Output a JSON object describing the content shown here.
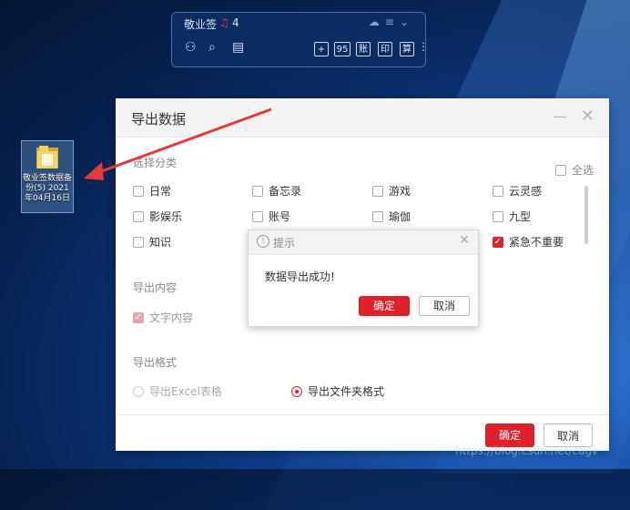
{
  "desktop": {
    "icon_label": "敬业签数据备份(5) 2021年04月16日"
  },
  "widget": {
    "title": "敬业签",
    "count": "4",
    "buttons": [
      "+",
      "95",
      "账",
      "印",
      "算"
    ]
  },
  "export_dialog": {
    "title": "导出数据",
    "section_category": "选择分类",
    "select_all": "全选",
    "categories": [
      "日常",
      "备忘录",
      "游戏",
      "云灵感",
      "影娱乐",
      "账号",
      "瑜伽",
      "九型",
      "知识",
      "紧急不重要"
    ],
    "checked_category": "紧急不重要",
    "section_content": "导出内容",
    "content_option": "文字内容",
    "section_format": "导出格式",
    "format_excel": "导出Excel表格",
    "format_folder": "导出文件夹格式",
    "selected_format": "导出文件夹格式",
    "confirm_label": "确定",
    "cancel_label": "取消"
  },
  "prompt_dialog": {
    "title": "提示",
    "message": "数据导出成功!",
    "confirm_label": "确定",
    "cancel_label": "取消"
  },
  "watermark": "https://blog.csdn.net/cagv",
  "colors": {
    "accent": "#e0212c",
    "desktop_bg": "#0f3f8f"
  }
}
